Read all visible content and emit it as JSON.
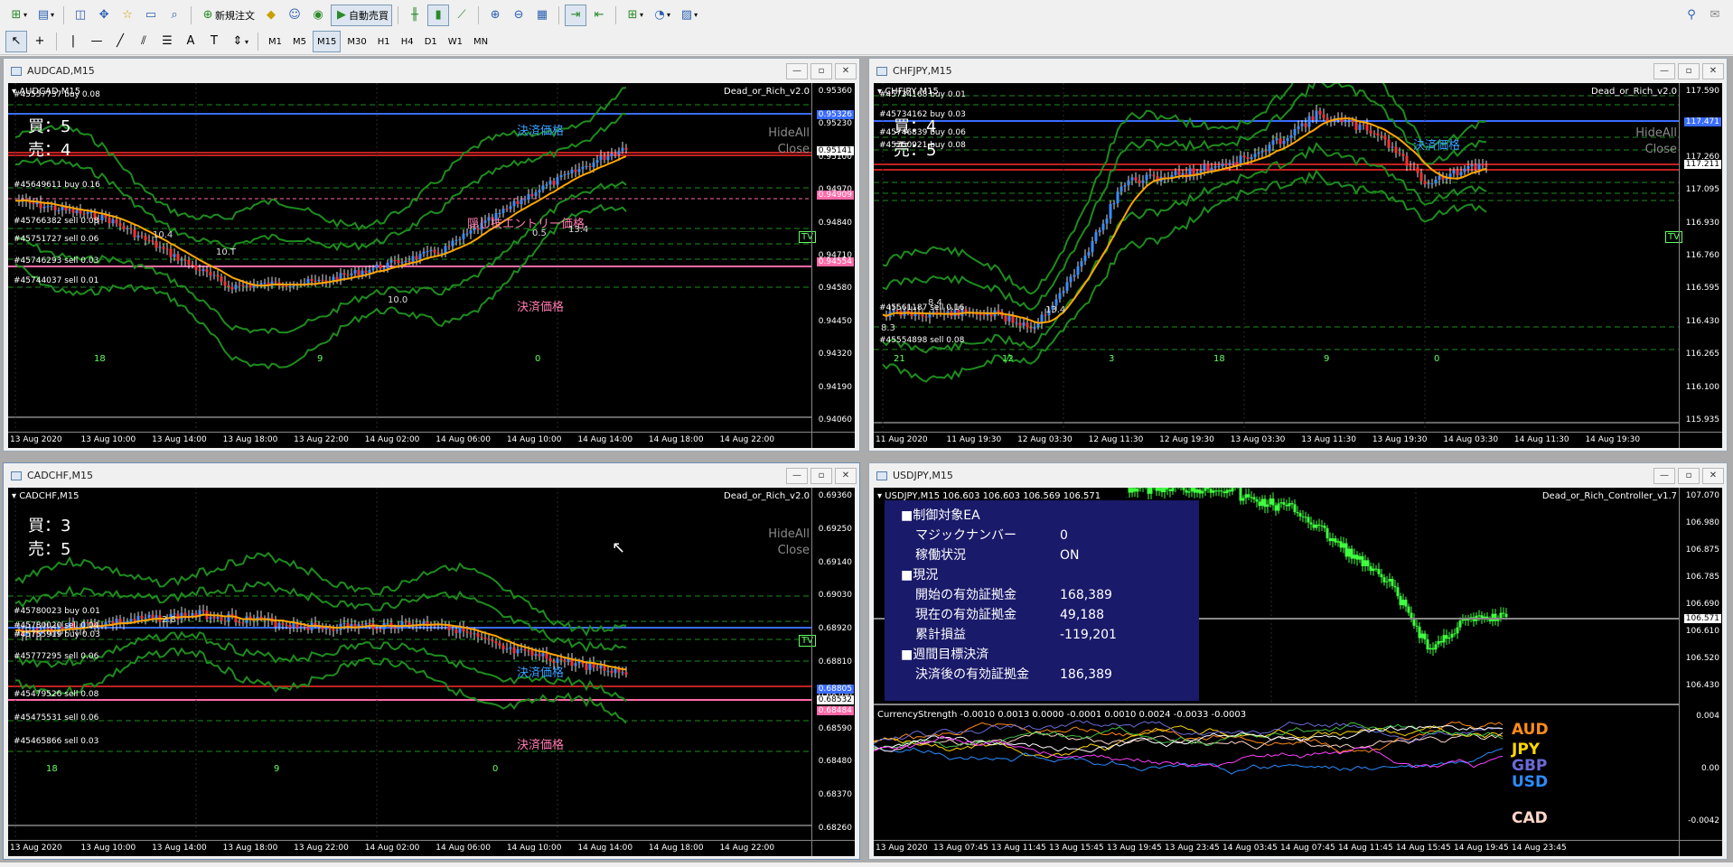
{
  "toolbar": {
    "new_order": "新規注文",
    "auto_trade": "自動売買",
    "timeframes": [
      "M1",
      "M5",
      "M15",
      "M30",
      "H1",
      "H4",
      "D1",
      "W1",
      "MN"
    ],
    "active_timeframe": "M15"
  },
  "colors": {
    "chart_bg": "#000000",
    "candle_up": "#3a8cff",
    "candle_down": "#ff3030",
    "ma": "#ffa500",
    "band": "#1e8c1e",
    "settle_line": "#3a6cff",
    "hidden_line": "#ff6aa8",
    "panel_bg": "#1a1a6a"
  },
  "windows": [
    {
      "title": "AUDCAD,M15",
      "symbol": "AUDCAD,M15",
      "ea": "Dead_or_Rich_v2.0",
      "buy_label": "買：5",
      "sell_label": "売：4",
      "hide_all": "HideAll",
      "close": "Close",
      "settle_label": "決済価格",
      "settle_label2": "決済価格",
      "hidden_label": "隠し技エントリー価格",
      "tv": "TV",
      "orders": [
        "#45557737 buy 0.08",
        "#45649611 buy 0.16",
        "#45766382 sell 0.08",
        "#45751727 sell 0.06",
        "#45746293 sell 0.03",
        "#45744037 sell 0.01"
      ],
      "prices": [
        "0.95360",
        "0.95230",
        "0.95100",
        "0.94970",
        "0.94840",
        "0.94710",
        "0.94580",
        "0.94450",
        "0.94320",
        "0.94190",
        "0.94060"
      ],
      "price_tags": [
        {
          "v": "0.95326",
          "c": "#3a6cff"
        },
        {
          "v": "0.95141",
          "c": "#ffffff"
        },
        {
          "v": "0.94909",
          "c": "#ff6aa8"
        },
        {
          "v": "0.94554",
          "c": "#ff6aa8"
        }
      ],
      "times": [
        "13 Aug 2020",
        "13 Aug 10:00",
        "13 Aug 14:00",
        "13 Aug 18:00",
        "13 Aug 22:00",
        "14 Aug 02:00",
        "14 Aug 06:00",
        "14 Aug 10:00",
        "14 Aug 14:00",
        "14 Aug 18:00",
        "14 Aug 22:00"
      ],
      "vlines": [
        "18",
        "9",
        "0"
      ],
      "marks": [
        "10.4",
        "10.T",
        "10.0",
        "0.5",
        "13.4"
      ]
    },
    {
      "title": "CHFJPY,M15",
      "symbol": "CHFJPY,M15",
      "ea": "Dead_or_Rich_v2.0",
      "buy_label": "買：4",
      "sell_label": "売：5",
      "hide_all": "HideAll",
      "close": "Close",
      "settle_label": "決済価格",
      "tv": "TV",
      "orders": [
        "#45734168 buy 0.01",
        "#45734162 buy 0.03",
        "#45746839 buy 0.06",
        "#45750921 buy 0.08",
        "#45561187 sell 0.16",
        "#45554898 sell 0.08"
      ],
      "prices": [
        "117.590",
        "117.425",
        "117.260",
        "117.095",
        "116.930",
        "116.760",
        "116.595",
        "116.430",
        "116.265",
        "116.100",
        "115.935"
      ],
      "price_tags": [
        {
          "v": "117.471",
          "c": "#3a6cff"
        },
        {
          "v": "117.211",
          "c": "#ffffff"
        }
      ],
      "times": [
        "11 Aug 2020",
        "11 Aug 19:30",
        "12 Aug 03:30",
        "12 Aug 11:30",
        "12 Aug 19:30",
        "13 Aug 03:30",
        "13 Aug 11:30",
        "13 Aug 19:30",
        "14 Aug 03:30",
        "14 Aug 11:30",
        "14 Aug 19:30"
      ],
      "vlines": [
        "21",
        "12",
        "3",
        "18",
        "9",
        "0"
      ],
      "marks": [
        "8.3",
        "8.4",
        "13.4"
      ]
    },
    {
      "title": "CADCHF,M15",
      "symbol": "CADCHF,M15",
      "ea": "Dead_or_Rich_v2.0",
      "buy_label": "買：3",
      "sell_label": "売：5",
      "hide_all": "HideAll",
      "close": "Close",
      "settle_label": "決済価格",
      "settle_label2": "決済価格",
      "tv": "TV",
      "orders": [
        "#45780023 buy 0.01",
        "#45780020 sell 0.04",
        "#45755919 buy 0.03",
        "#45777295 sell 0.06",
        "#45479526 sell 0.08",
        "#45475531 sell 0.06",
        "#45465866 sell 0.03"
      ],
      "prices": [
        "0.69360",
        "0.69250",
        "0.69140",
        "0.69030",
        "0.68920",
        "0.68810",
        "0.68700",
        "0.68590",
        "0.68480",
        "0.68370",
        "0.68260"
      ],
      "price_tags": [
        {
          "v": "0.68805",
          "c": "#3a6cff"
        },
        {
          "v": "0.68532",
          "c": "#ffffff"
        },
        {
          "v": "0.68484",
          "c": "#ff6aa8"
        }
      ],
      "times": [
        "13 Aug 2020",
        "13 Aug 10:00",
        "13 Aug 14:00",
        "13 Aug 18:00",
        "13 Aug 22:00",
        "14 Aug 02:00",
        "14 Aug 06:00",
        "14 Aug 10:00",
        "14 Aug 14:00",
        "14 Aug 18:00",
        "14 Aug 22:00"
      ],
      "vlines": [
        "18",
        "9",
        "0"
      ],
      "marks": [
        "2.8"
      ]
    },
    {
      "title": "USDJPY,M15",
      "symbol": "USDJPY,M15  106.603 106.603 106.569 106.571",
      "ea": "Dead_or_Rich_Controller_v1.7",
      "panel": {
        "h1": "■制御対象EA",
        "magic_k": "マジックナンバー",
        "magic_v": "0",
        "status_k": "稼働状況",
        "status_v": "ON",
        "h2": "■現況",
        "start_k": "開始の有効証拠金",
        "start_v": "168,389",
        "current_k": "現在の有効証拠金",
        "current_v": "49,188",
        "pl_k": "累計損益",
        "pl_v": "-119,201",
        "h3": "■週間目標決済",
        "after_k": "決済後の有効証拠金",
        "after_v": "186,389"
      },
      "prices": [
        "107.070",
        "106.980",
        "106.875",
        "106.785",
        "106.690",
        "106.610",
        "106.520",
        "106.430"
      ],
      "price_tag": "106.571",
      "indicator": "CurrencyStrength -0.0010 0.0013 0.0000 -0.0001 0.0010 0.0024 -0.0033 -0.0003",
      "ind_scale": [
        "0.004",
        "0.00",
        "-0.0042"
      ],
      "currencies": [
        {
          "name": "AUD",
          "color": "#ff8c1a"
        },
        {
          "name": "JPY",
          "color": "#ffd700"
        },
        {
          "name": "GBP",
          "color": "#6a6ad8"
        },
        {
          "name": "USD",
          "color": "#2a8cff"
        },
        {
          "name": "CAD",
          "color": "#ffd6c8"
        }
      ],
      "times": [
        "13 Aug 2020",
        "13 Aug 07:45",
        "13 Aug 11:45",
        "13 Aug 15:45",
        "13 Aug 19:45",
        "13 Aug 23:45",
        "14 Aug 03:45",
        "14 Aug 07:45",
        "14 Aug 11:45",
        "14 Aug 15:45",
        "14 Aug 19:45",
        "14 Aug 23:45"
      ]
    }
  ]
}
